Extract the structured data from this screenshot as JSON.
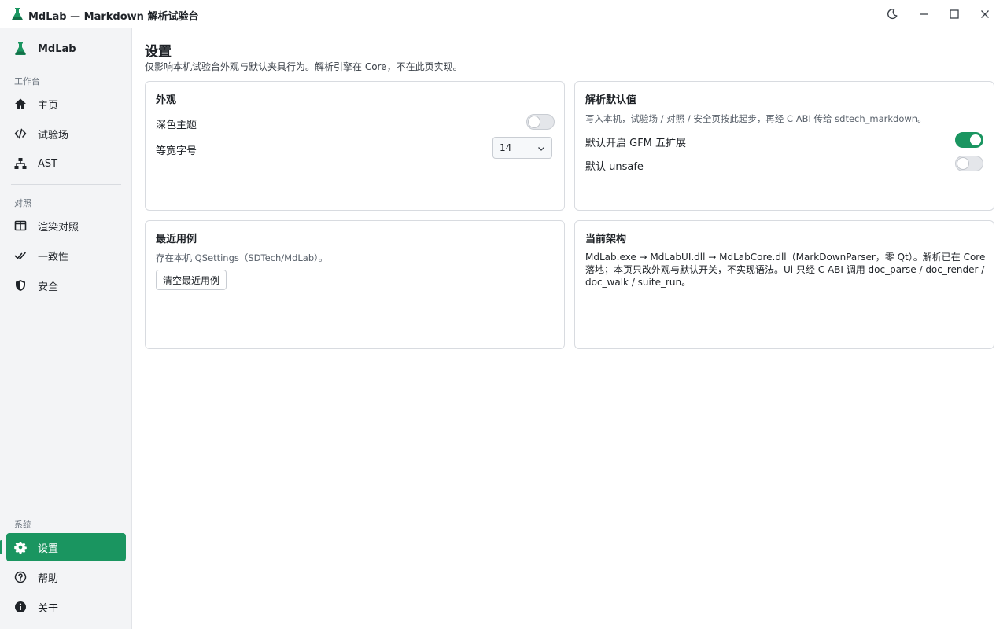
{
  "window": {
    "title": "MdLab — Markdown 解析试验台",
    "icons": [
      "flask-icon",
      "moon-icon",
      "minimize-icon",
      "maximize-icon",
      "close-icon"
    ]
  },
  "colors": {
    "accent": "#1a9560",
    "sidebar_bg": "#f3f4f6",
    "border": "#d8dbe0"
  },
  "sidebar": {
    "brand": "MdLab",
    "sections": [
      {
        "label": "工作台",
        "items": [
          {
            "label": "主页",
            "icon": "home-icon"
          },
          {
            "label": "试验场",
            "icon": "code-icon"
          },
          {
            "label": "AST",
            "icon": "tree-icon"
          }
        ]
      },
      {
        "label": "对照",
        "items": [
          {
            "label": "渲染对照",
            "icon": "columns-icon"
          },
          {
            "label": "一致性",
            "icon": "double-check-icon"
          },
          {
            "label": "安全",
            "icon": "shield-icon"
          }
        ]
      },
      {
        "label": "系统",
        "items": [
          {
            "label": "设置",
            "icon": "gear-icon",
            "active": true
          },
          {
            "label": "帮助",
            "icon": "help-icon"
          },
          {
            "label": "关于",
            "icon": "info-icon"
          }
        ]
      }
    ]
  },
  "page": {
    "title": "设置",
    "subtitle": "仅影响本机试验台外观与默认夹具行为。解析引擎在 Core，不在此页实现。"
  },
  "appearance": {
    "title": "外观",
    "dark_theme_label": "深色主题",
    "dark_theme_on": false,
    "mono_size_label": "等宽字号",
    "mono_size_value": "14"
  },
  "parse_defaults": {
    "title": "解析默认值",
    "desc": "写入本机，试验场 / 对照 / 安全页按此起步，再经 C ABI 传给 sdtech_markdown。",
    "gfm_label": "默认开启 GFM 五扩展",
    "gfm_on": true,
    "unsafe_label": "默认 unsafe",
    "unsafe_on": false
  },
  "recent": {
    "title": "最近用例",
    "desc": "存在本机 QSettings（SDTech/MdLab）。",
    "clear_label": "清空最近用例"
  },
  "architecture": {
    "title": "当前架构",
    "text": "MdLab.exe → MdLabUI.dll → MdLabCore.dll（MarkDownParser，零 Qt）。解析已在 Core 落地；本页只改外观与默认开关，不实现语法。Ui 只经 C ABI 调用 doc_parse / doc_render / doc_walk / suite_run。"
  }
}
